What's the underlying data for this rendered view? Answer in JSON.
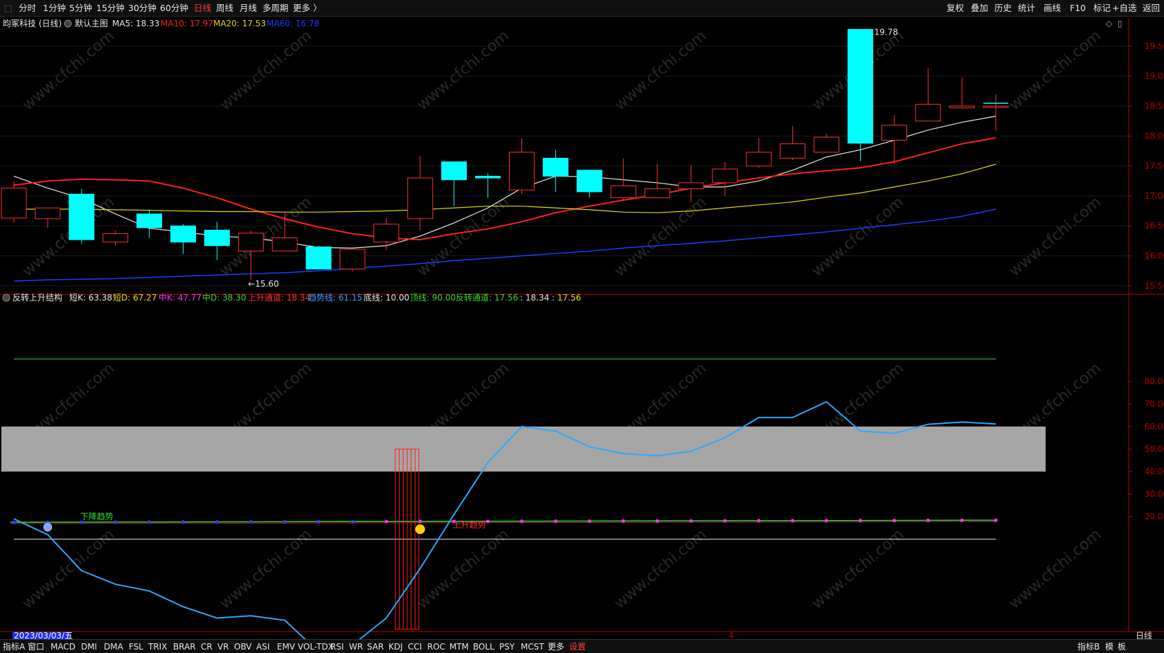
{
  "toolbar": {
    "back_glyph": "⬚",
    "periods": [
      "分时",
      "1分钟",
      "5分钟",
      "15分钟",
      "30分钟",
      "60分钟",
      "日线",
      "周线",
      "月线",
      "多周期",
      "更多 〉"
    ],
    "active_period": "日线",
    "right_items": [
      "复权",
      "叠加",
      "历史",
      "统计",
      "画线",
      "F10",
      "标记",
      "+自选",
      "返回"
    ]
  },
  "main_header": {
    "stock": "昀冢科技 (日线)",
    "template": "默认主图",
    "ma5": "MA5: 18.33",
    "ma10": "MA10: 17.97",
    "ma20": "MA20: 17.53",
    "ma60": "MA60: 16.78"
  },
  "sub_header": {
    "name": "反转上升结构",
    "items": [
      {
        "text": "短K: 63.38",
        "color": "#e8e8e8"
      },
      {
        "text": "短D: 67.27",
        "color": "#e8e800"
      },
      {
        "text": "中K: 47.77",
        "color": "#ff33ff"
      },
      {
        "text": "中D: 38.30",
        "color": "#33dd33"
      },
      {
        "text": "上升通道: 18.34",
        "color": "#ff3333"
      },
      {
        "text": "趋势线: 61.15",
        "color": "#3aa0ff"
      },
      {
        "text": "底线: 10.00",
        "color": "#e8e8e8"
      },
      {
        "text": "顶线: 90.00",
        "color": "#33dd33"
      },
      {
        "text": "反转通道: 17.56",
        "color": "#33dd33"
      },
      {
        "text": ": 18.34",
        "color": "#e8e8e8"
      },
      {
        "text": ": 17.56",
        "color": "#e8e800"
      }
    ]
  },
  "annotations": {
    "high_label": "19.78",
    "low_label": "←15.60",
    "down_trend": "下降趋势",
    "up_trend": "上升趋势",
    "date_label": "2023/03/03/五",
    "month_marker": "4",
    "period_label": "日线"
  },
  "bottom_bar": {
    "left_items": [
      "指标A",
      "窗口",
      "MACD",
      "DMI",
      "DMA",
      "FSL",
      "TRIX",
      "BRAR",
      "CR",
      "VR",
      "OBV",
      "ASI",
      "EMV",
      "VOL-TDX",
      "RSI",
      "WR",
      "SAR",
      "KDJ",
      "CCI",
      "ROC",
      "MTM",
      "BOLL",
      "PSY",
      "MCST",
      "更多"
    ],
    "settings": "设置",
    "right_items": [
      "指标B",
      "模",
      "板"
    ]
  },
  "watermark": "www.cfchi.com",
  "colors": {
    "up": "#ff3232",
    "down": "#00ffff",
    "ma5": "#e8e8e8",
    "ma10": "#ff2020",
    "ma20": "#dddd00",
    "ma60": "#1a3fff",
    "trend": "#2aa8ff",
    "band": "#a6a6a6",
    "axis": "#c00000"
  },
  "chart_data": [
    {
      "type": "candlestick",
      "title": "昀冢科技 (日线)",
      "y_ticks": [
        15.5,
        16.0,
        16.5,
        17.0,
        17.5,
        18.0,
        18.5,
        19.0,
        19.5
      ],
      "ylim": [
        15.37,
        19.97
      ],
      "candles": [
        {
          "o": 16.63,
          "h": 17.25,
          "l": 16.55,
          "c": 17.13
        },
        {
          "o": 16.62,
          "h": 16.8,
          "l": 16.47,
          "c": 16.8
        },
        {
          "o": 17.03,
          "h": 17.12,
          "l": 16.2,
          "c": 16.27
        },
        {
          "o": 16.23,
          "h": 16.43,
          "l": 16.17,
          "c": 16.37
        },
        {
          "o": 16.7,
          "h": 16.77,
          "l": 16.3,
          "c": 16.47
        },
        {
          "o": 16.5,
          "h": 16.53,
          "l": 16.03,
          "c": 16.23
        },
        {
          "o": 16.43,
          "h": 16.57,
          "l": 15.93,
          "c": 16.17
        },
        {
          "o": 16.08,
          "h": 16.43,
          "l": 15.6,
          "c": 16.38
        },
        {
          "o": 16.08,
          "h": 16.75,
          "l": 16.08,
          "c": 16.3
        },
        {
          "o": 16.15,
          "h": 16.17,
          "l": 15.78,
          "c": 15.78
        },
        {
          "o": 15.78,
          "h": 16.11,
          "l": 15.74,
          "c": 16.11
        },
        {
          "o": 16.23,
          "h": 16.63,
          "l": 16.1,
          "c": 16.53
        },
        {
          "o": 16.62,
          "h": 17.67,
          "l": 16.43,
          "c": 17.3
        },
        {
          "o": 17.57,
          "h": 17.57,
          "l": 16.83,
          "c": 17.27
        },
        {
          "o": 17.33,
          "h": 17.38,
          "l": 16.97,
          "c": 17.3
        },
        {
          "o": 17.1,
          "h": 17.97,
          "l": 17.03,
          "c": 17.73
        },
        {
          "o": 17.63,
          "h": 17.77,
          "l": 17.07,
          "c": 17.33
        },
        {
          "o": 17.43,
          "h": 17.43,
          "l": 16.97,
          "c": 17.07
        },
        {
          "o": 16.97,
          "h": 17.63,
          "l": 16.92,
          "c": 17.17
        },
        {
          "o": 16.97,
          "h": 17.53,
          "l": 16.97,
          "c": 17.12
        },
        {
          "o": 17.12,
          "h": 17.52,
          "l": 16.9,
          "c": 17.22
        },
        {
          "o": 17.22,
          "h": 17.57,
          "l": 17.0,
          "c": 17.45
        },
        {
          "o": 17.5,
          "h": 17.97,
          "l": 17.47,
          "c": 17.73
        },
        {
          "o": 17.63,
          "h": 18.17,
          "l": 17.6,
          "c": 17.87
        },
        {
          "o": 17.73,
          "h": 18.03,
          "l": 17.73,
          "c": 17.98
        },
        {
          "o": 19.78,
          "h": 19.78,
          "l": 17.58,
          "c": 17.88
        },
        {
          "o": 17.93,
          "h": 18.35,
          "l": 17.53,
          "c": 18.18
        },
        {
          "o": 18.25,
          "h": 19.13,
          "l": 18.25,
          "c": 18.53
        },
        {
          "o": 18.47,
          "h": 18.98,
          "l": 18.45,
          "c": 18.5
        },
        {
          "o": 18.5,
          "h": 18.7,
          "l": 18.08,
          "c": 18.5
        }
      ],
      "series": [
        {
          "name": "MA5",
          "values": [
            17.33,
            17.13,
            16.96,
            16.7,
            16.46,
            16.4,
            16.33,
            16.3,
            16.23,
            16.14,
            16.13,
            16.17,
            16.33,
            16.55,
            16.8,
            17.13,
            17.33,
            17.32,
            17.27,
            17.22,
            17.15,
            17.15,
            17.25,
            17.43,
            17.65,
            17.77,
            17.93,
            18.1,
            18.23,
            18.33
          ]
        },
        {
          "name": "MA10",
          "values": [
            17.18,
            17.25,
            17.28,
            17.27,
            17.25,
            17.13,
            16.97,
            16.78,
            16.62,
            16.48,
            16.37,
            16.3,
            16.27,
            16.37,
            16.45,
            16.57,
            16.72,
            16.83,
            16.93,
            17.02,
            17.13,
            17.22,
            17.3,
            17.37,
            17.42,
            17.47,
            17.57,
            17.72,
            17.87,
            17.97
          ]
        },
        {
          "name": "MA20",
          "values": [
            16.78,
            16.78,
            16.78,
            16.77,
            16.76,
            16.75,
            16.74,
            16.74,
            16.73,
            16.73,
            16.74,
            16.75,
            16.77,
            16.8,
            16.83,
            16.83,
            16.8,
            16.77,
            16.73,
            16.72,
            16.75,
            16.8,
            16.85,
            16.9,
            16.98,
            17.05,
            17.15,
            17.25,
            17.37,
            17.53
          ]
        },
        {
          "name": "MA60",
          "values": [
            15.58,
            15.6,
            15.61,
            15.62,
            15.64,
            15.66,
            15.68,
            15.7,
            15.72,
            15.75,
            15.79,
            15.83,
            15.87,
            15.92,
            15.96,
            16.0,
            16.04,
            16.08,
            16.13,
            16.17,
            16.21,
            16.25,
            16.3,
            16.35,
            16.4,
            16.46,
            16.52,
            16.58,
            16.66,
            16.78
          ]
        }
      ]
    },
    {
      "type": "line",
      "title": "反转上升结构",
      "y_ticks": [
        20,
        30,
        40,
        50,
        60,
        70,
        80
      ],
      "ylim": [
        -31,
        119
      ],
      "bands": [
        {
          "from": 40,
          "to": 60
        }
      ],
      "series": [
        {
          "name": "趋势线",
          "values": [
            19,
            12,
            -4,
            -10,
            -13,
            -20,
            -25,
            -24,
            -26,
            -40,
            -37,
            -25,
            -3,
            21,
            44,
            60,
            58,
            51,
            48,
            47,
            49,
            55,
            64,
            64,
            71,
            58,
            57,
            61,
            62,
            61.15
          ]
        },
        {
          "name": "顶线",
          "values": [
            90
          ]
        },
        {
          "name": "底线",
          "values": [
            10
          ]
        }
      ],
      "channel_values": [
        18.34,
        17.56
      ],
      "signal_bar": {
        "index": 11,
        "from": 50,
        "to": -30
      }
    }
  ]
}
